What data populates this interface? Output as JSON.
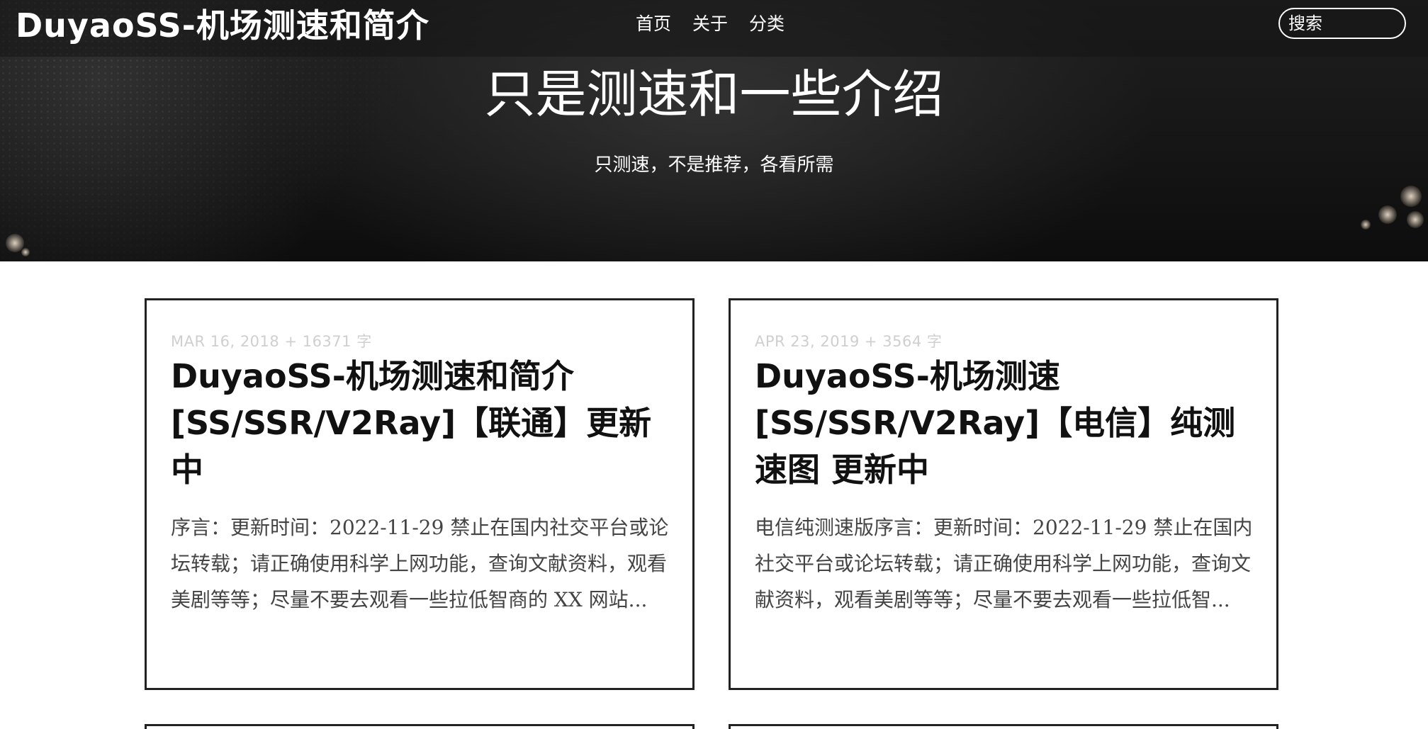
{
  "site": {
    "brand": "DuyaoSS-机场测速和简介"
  },
  "nav": {
    "items": [
      {
        "label": "首页"
      },
      {
        "label": "关于"
      },
      {
        "label": "分类"
      }
    ],
    "search_placeholder": "搜索"
  },
  "hero": {
    "title": "只是测速和一些介绍",
    "subtitle": "只测速，不是推荐，各看所需"
  },
  "posts": [
    {
      "meta": "MAR 16, 2018 + 16371 字",
      "title": "DuyaoSS-机场测速和简介[SS/SSR/V2Ray]【联通】更新中",
      "excerpt": "序言：更新时间：2022-11-29 禁止在国内社交平台或论坛转载；请正确使用科学上网功能，查询文献资料，观看美剧等等；尽量不要去观看一些拉低智商的 XX 网站..."
    },
    {
      "meta": "APR 23, 2019 + 3564 字",
      "title": "DuyaoSS-机场测速[SS/SSR/V2Ray]【电信】纯测速图 更新中",
      "excerpt": "电信纯测速版序言：更新时间：2022-11-29 禁止在国内社交平台或论坛转载；请正确使用科学上网功能，查询文献资料，观看美剧等等；尽量不要去观看一些拉低智..."
    }
  ],
  "colors": {
    "hero_background": "#151515",
    "card_border": "#222222",
    "meta_text": "#cfcfcf",
    "excerpt_text": "#444444"
  }
}
